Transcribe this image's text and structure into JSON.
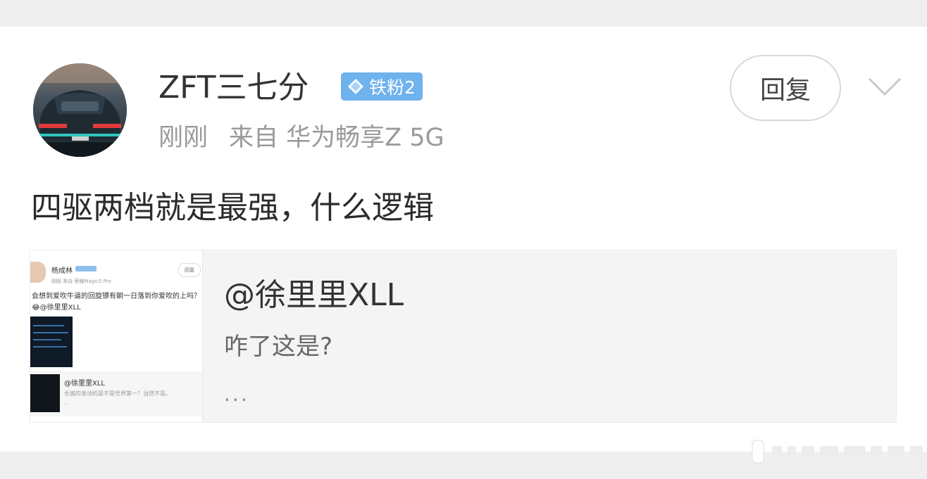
{
  "post": {
    "username": "ZFT三七分",
    "badge": {
      "label": "铁粉2",
      "color": "#6eb2ee",
      "icon": "diamond-icon"
    },
    "time": "刚刚",
    "source": "来自 华为畅享Z 5G",
    "reply_label": "回复",
    "menu_icon": "chevron-down-icon",
    "text": "四驱两档就是最强，什么逻辑"
  },
  "quote": {
    "author": "@徐里里XLL",
    "text": "咋了这是?",
    "ellipsis": "...",
    "thumbnail": {
      "name": "杨成林",
      "meta": "刚刚 来自 荣耀Magic5 Pro",
      "reply": "回复",
      "text": "会想到爱吹牛逼的回旋镖有朝一日落到你爱吹的上吗？😂@徐里里XLL",
      "quote_author": "@徐里里XLL",
      "quote_text": "长城的发动机是不是世界第一？当然不是。",
      "quote_ellipsis": "..."
    }
  }
}
